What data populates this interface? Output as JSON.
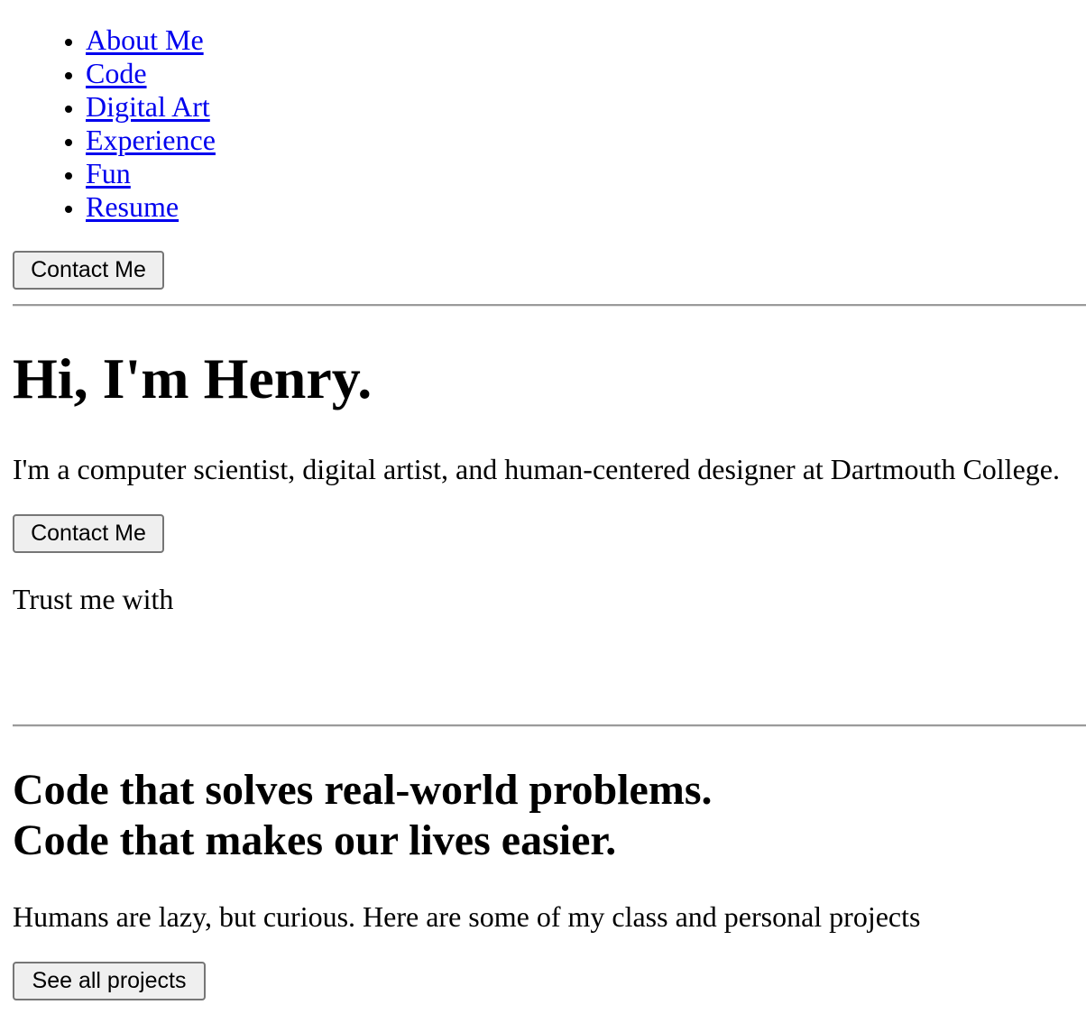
{
  "nav": {
    "items": [
      {
        "label": "About Me"
      },
      {
        "label": "Code"
      },
      {
        "label": "Digital Art"
      },
      {
        "label": "Experience"
      },
      {
        "label": "Fun"
      },
      {
        "label": "Resume"
      }
    ],
    "contact_label": "Contact Me"
  },
  "hero": {
    "title": "Hi, I'm Henry.",
    "description": "I'm a computer scientist, digital artist, and human-centered designer at Dartmouth College.",
    "contact_label": "Contact Me",
    "trust_text": "Trust me with"
  },
  "code_section": {
    "title_line1": "Code that solves real-world problems.",
    "title_line2": "Code that makes our lives easier.",
    "description": "Humans are lazy, but curious. Here are some of my class and personal projects",
    "button_label": "See all projects"
  },
  "colors": {
    "link": "#0000ee",
    "button_bg": "#efefef",
    "button_border": "#767676",
    "rule": "#9a9a9a"
  }
}
